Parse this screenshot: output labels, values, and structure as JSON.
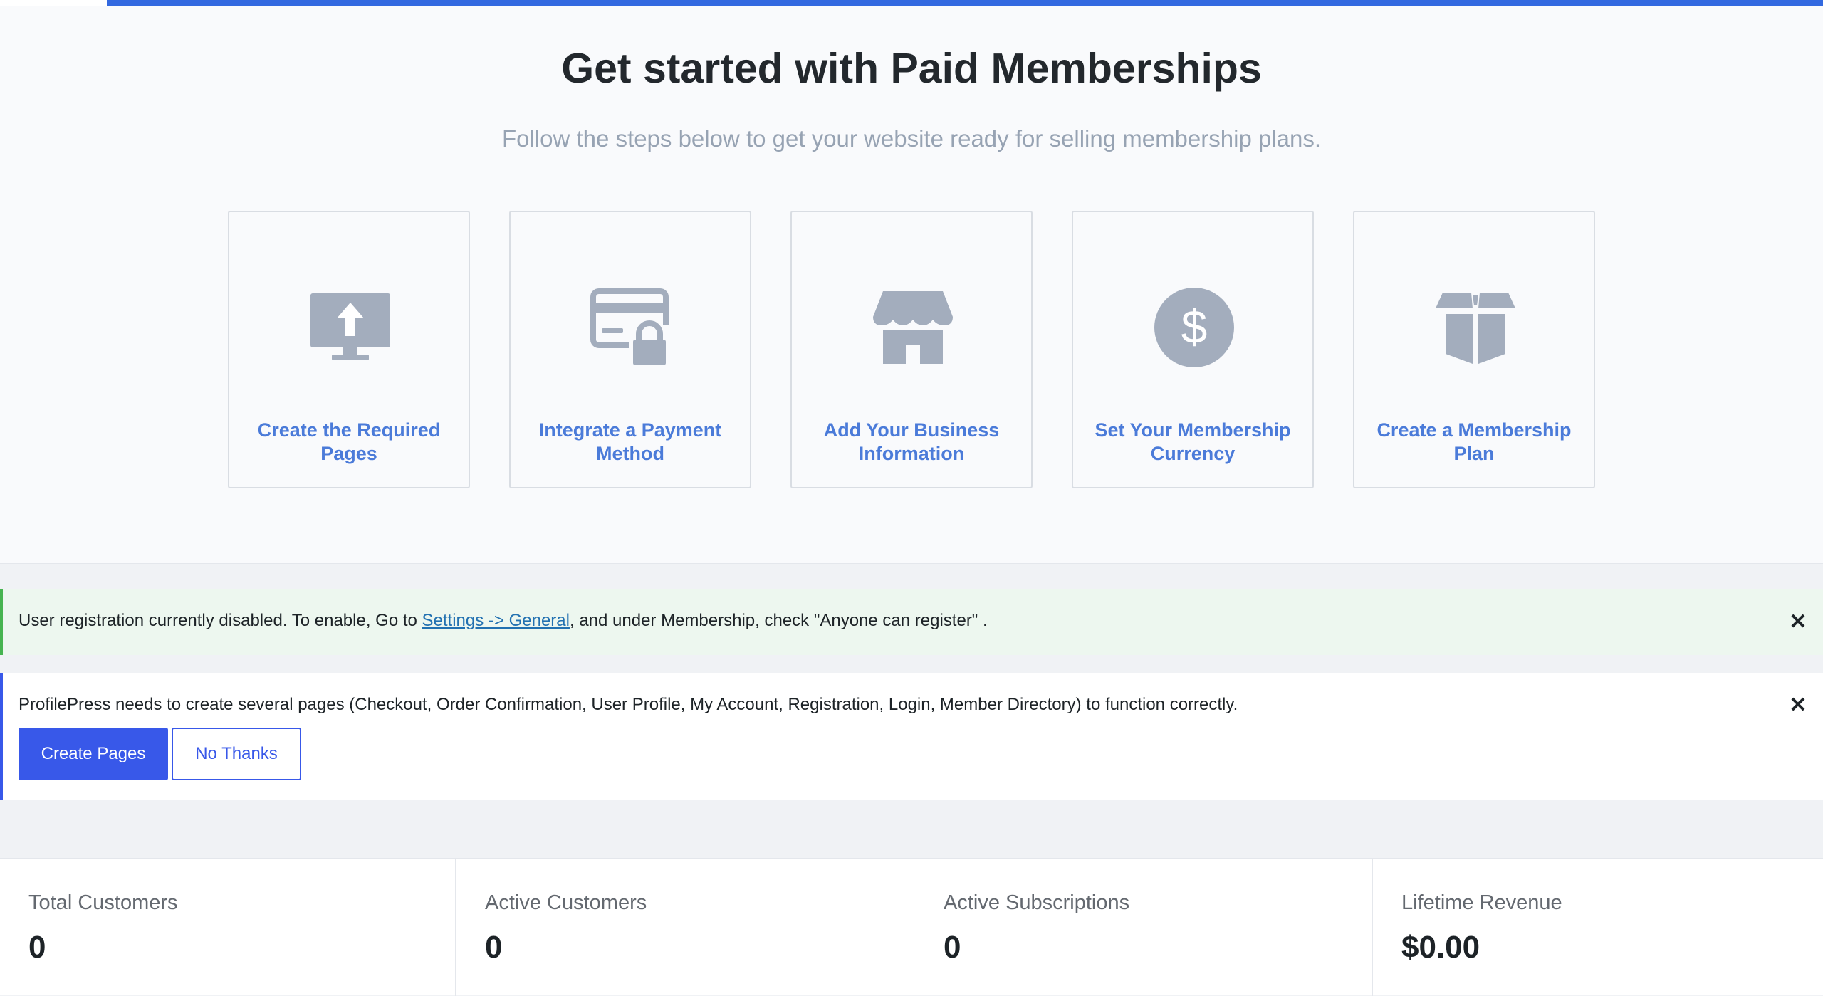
{
  "onboarding": {
    "title": "Get started with Paid Memberships",
    "subtitle": "Follow the steps below to get your website ready for selling membership plans.",
    "steps": [
      {
        "label": "Create the Required Pages",
        "icon": "monitor-upload-icon"
      },
      {
        "label": "Integrate a Payment Method",
        "icon": "credit-card-lock-icon"
      },
      {
        "label": "Add Your Business Information",
        "icon": "storefront-icon"
      },
      {
        "label": "Set Your Membership Currency",
        "icon": "dollar-circle-icon"
      },
      {
        "label": "Create a Membership Plan",
        "icon": "box-icon"
      }
    ]
  },
  "notices": {
    "registration": {
      "text_before": "User registration currently disabled. To enable, Go to ",
      "link": "Settings -> General",
      "text_after": ", and under Membership, check \"Anyone can register\" .",
      "close": "✕"
    },
    "pages": {
      "text": "ProfilePress needs to create several pages (Checkout, Order Confirmation, User Profile, My Account, Registration, Login, Member Directory) to function correctly.",
      "create_label": "Create Pages",
      "dismiss_label": "No Thanks",
      "close": "✕"
    }
  },
  "stats": [
    {
      "label": "Total Customers",
      "value": "0"
    },
    {
      "label": "Active Customers",
      "value": "0"
    },
    {
      "label": "Active Subscriptions",
      "value": "0"
    },
    {
      "label": "Lifetime Revenue",
      "value": "$0.00"
    }
  ],
  "colors": {
    "accent": "#3858e9",
    "step_link": "#4b7bd9",
    "icon_gray": "#a3adbd",
    "success": "#46b450"
  }
}
